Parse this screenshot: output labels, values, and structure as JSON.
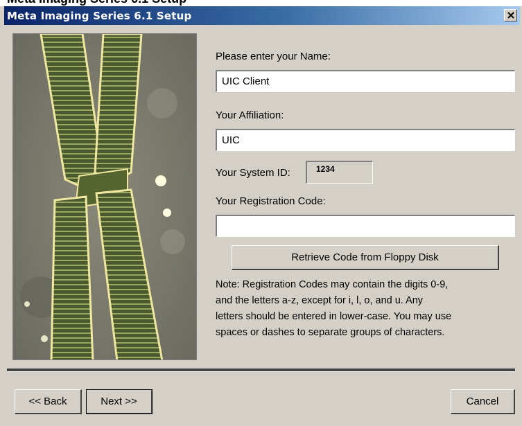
{
  "window": {
    "title": "Meta Imaging Series 6.1 Setup",
    "partial_caption": "Meta Imaging Series 6.1 Setup",
    "close_icon": "close-icon"
  },
  "image": {
    "icon": "micrograph-image",
    "background": "#7c7a70",
    "fiber_color": "#4a5a2e",
    "highlight_color": "#f0e8a0"
  },
  "form": {
    "name_label": "Please enter your Name:",
    "name_value": "UIC Client",
    "affiliation_label": "Your Affiliation:",
    "affiliation_value": "UIC",
    "system_id_label": "Your System ID:",
    "system_id_value": "1234",
    "registration_label": "Your Registration Code:",
    "registration_value": "",
    "retrieve_button": "Retrieve Code from Floppy Disk",
    "note_lines": [
      "Note: Registration Codes may contain the digits 0-9,",
      "and the letters a-z, except for i, l, o, and u.  Any",
      "letters should be entered in lower-case.  You may use",
      "spaces or dashes to separate groups of characters."
    ]
  },
  "footer": {
    "back_button": "<< Back",
    "next_button": "Next >>",
    "cancel_button": "Cancel"
  },
  "colors": {
    "dialog_background": "#d4d0c8",
    "titlebar_start": "#0a246a",
    "titlebar_end": "#a6caf0"
  }
}
